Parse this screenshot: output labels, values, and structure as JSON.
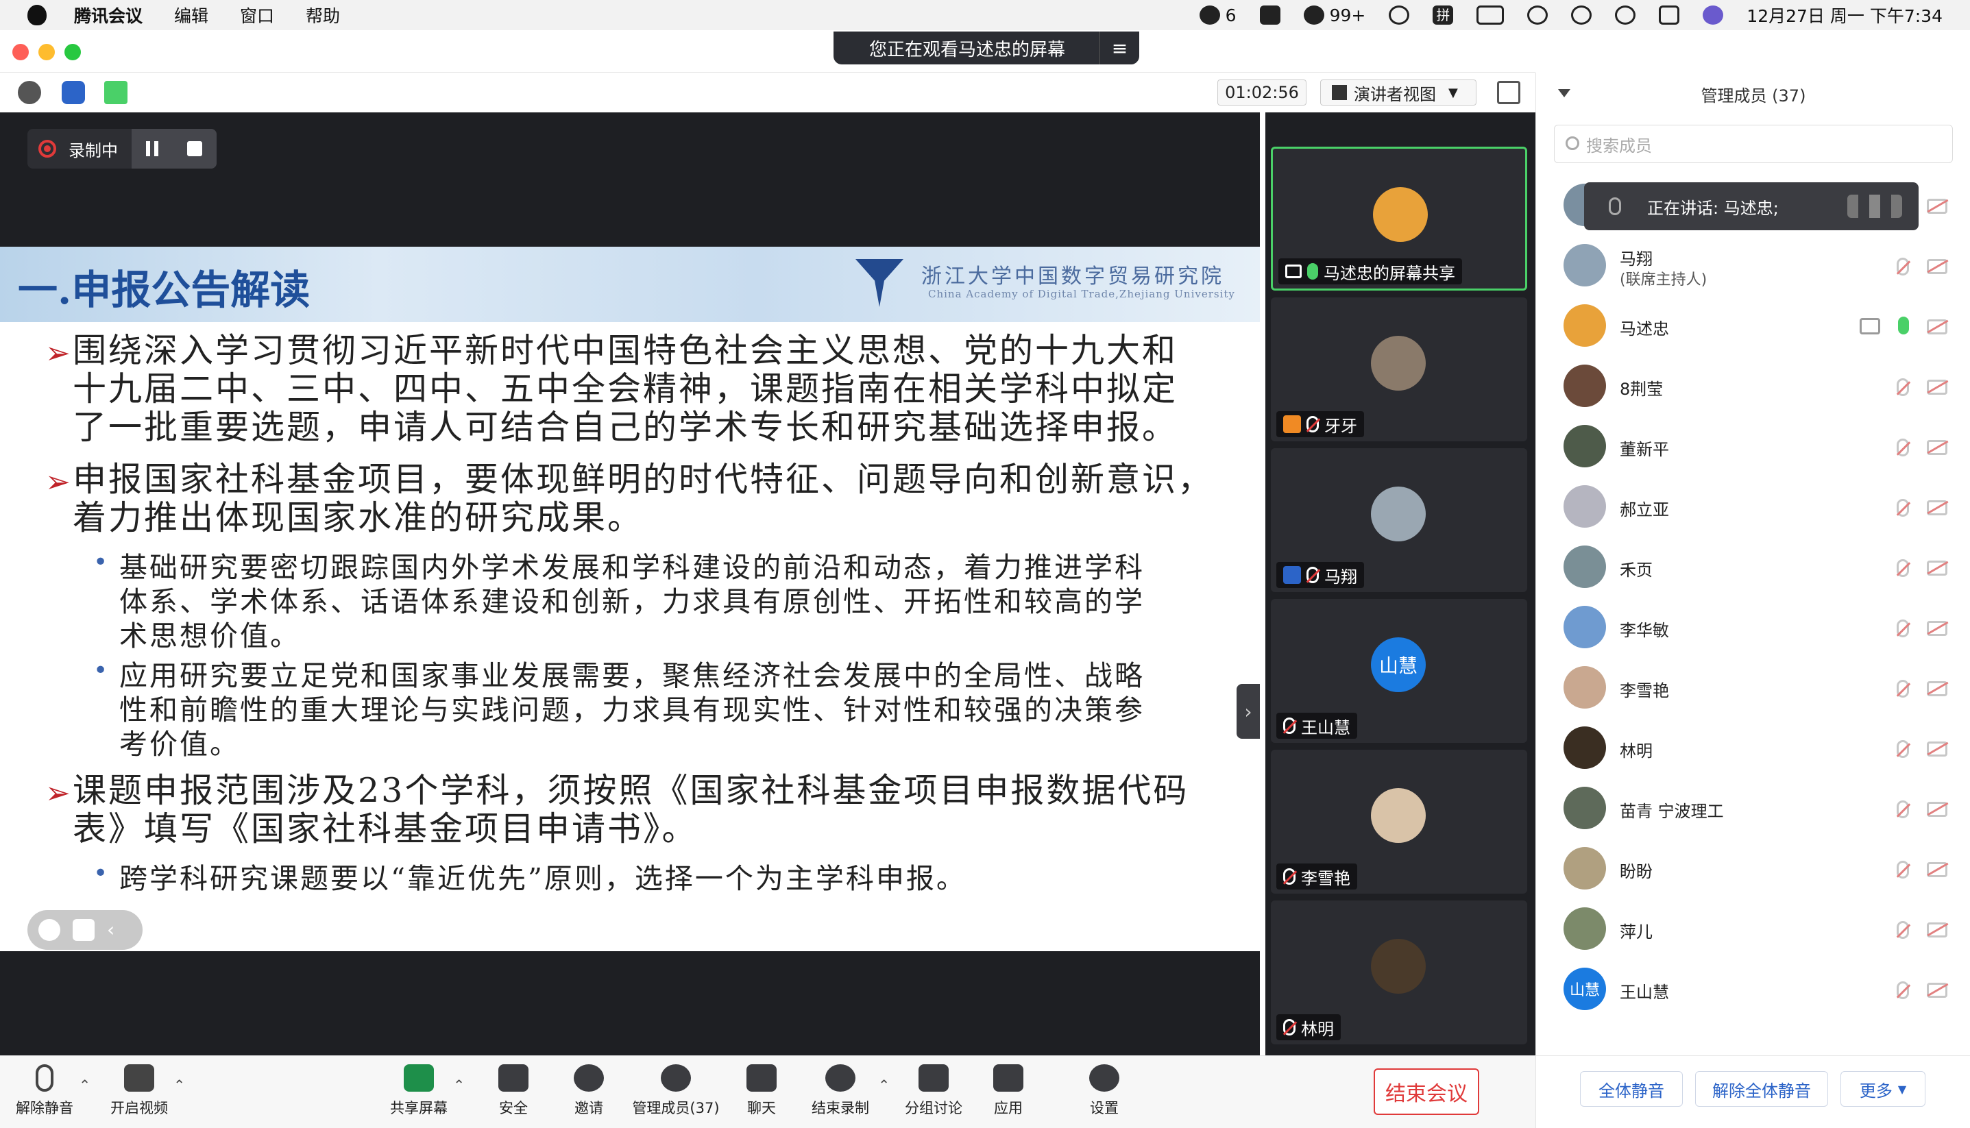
{
  "menubar": {
    "app_name": "腾讯会议",
    "items": [
      "编辑",
      "窗口",
      "帮助"
    ],
    "tray": {
      "badge1": "6",
      "badge2": "99+",
      "ime": "拼",
      "datetime": "12月27日 周一 下午7:34"
    }
  },
  "window": {
    "viewing_banner": "您正在观看马述忠的屏幕",
    "timer": "01:02:56",
    "view_mode": "演讲者视图"
  },
  "recording": {
    "label": "录制中"
  },
  "slide": {
    "title": "一.申报公告解读",
    "institute_cn": "浙江大学中国数字贸易研究院",
    "institute_en": "China Academy of Digital Trade,Zhejiang University",
    "bullets": [
      "围绕深入学习贯彻习近平新时代中国特色社会主义思想、党的十九大和",
      "十九届二中、三中、四中、五中全会精神，课题指南在相关学科中拟定",
      "了一批重要选题，申请人可结合自己的学术专长和研究基础选择申报。",
      "申报国家社科基金项目，要体现鲜明的时代特征、问题导向和创新意识，",
      "着力推出体现国家水准的研究成果。",
      "基础研究要密切跟踪国内外学术发展和学科建设的前沿和动态，着力推进学科",
      "体系、学术体系、话语体系建设和创新，力求具有原创性、开拓性和较高的学",
      "术思想价值。",
      "应用研究要立足党和国家事业发展需要，聚焦经济社会发展中的全局性、战略",
      "性和前瞻性的重大理论与实践问题，力求具有现实性、针对性和较强的决策参",
      "考价值。",
      "课题申报范围涉及23个学科，须按照《国家社科基金项目申报数据代码",
      "表》填写《国家社科基金项目申请书》。",
      "跨学科研究课题要以“靠近优先”原则，选择一个为主学科申报。"
    ]
  },
  "thumbnails": [
    {
      "name": "马述忠的屏幕共享",
      "color": "#e8a23a"
    },
    {
      "name": "牙牙",
      "color": "#8a7a6a"
    },
    {
      "name": "马翔",
      "color": "#9aa7b2"
    },
    {
      "name": "王山慧",
      "color": "#1b7be0",
      "initials": "山慧"
    },
    {
      "name": "李雪艳",
      "color": "#d9c3a8"
    },
    {
      "name": "林明",
      "color": "#4a3a2a"
    }
  ],
  "toolbar": {
    "unmute": "解除静音",
    "start_video": "开启视频",
    "share_screen": "共享屏幕",
    "security": "安全",
    "invite": "邀请",
    "manage_members": "管理成员(37)",
    "chat": "聊天",
    "end_recording": "结束录制",
    "breakout": "分组讨论",
    "apps": "应用",
    "settings": "设置",
    "end_meeting": "结束会议"
  },
  "panel": {
    "title": "管理成员 (37)",
    "search_placeholder": "搜索成员",
    "speaking": "正在讲话: 马述忠;",
    "members": [
      {
        "name": "马翔",
        "sub": "(联席主持人)",
        "color": "#8fa3b5"
      },
      {
        "name": "马述忠",
        "sub": "",
        "color": "#e8a23a"
      },
      {
        "name": "8荆莹",
        "sub": "",
        "color": "#6b4a3a"
      },
      {
        "name": "董新平",
        "sub": "",
        "color": "#4e5b4a"
      },
      {
        "name": "郝立亚",
        "sub": "",
        "color": "#b5b5c0"
      },
      {
        "name": "禾页",
        "sub": "",
        "color": "#7a8f96"
      },
      {
        "name": "李华敏",
        "sub": "",
        "color": "#6f9bd0"
      },
      {
        "name": "李雪艳",
        "sub": "",
        "color": "#c9a890"
      },
      {
        "name": "林明",
        "sub": "",
        "color": "#3a2e22"
      },
      {
        "name": "苗青 宁波理工",
        "sub": "",
        "color": "#5e6a5a"
      },
      {
        "name": "盼盼",
        "sub": "",
        "color": "#b0a080"
      },
      {
        "name": "萍儿",
        "sub": "",
        "color": "#7c8a6a"
      },
      {
        "name": "王山慧",
        "sub": "",
        "color": "#1b7be0",
        "initials": "山慧"
      }
    ],
    "mute_all": "全体静音",
    "unmute_all": "解除全体静音",
    "more": "更多"
  }
}
